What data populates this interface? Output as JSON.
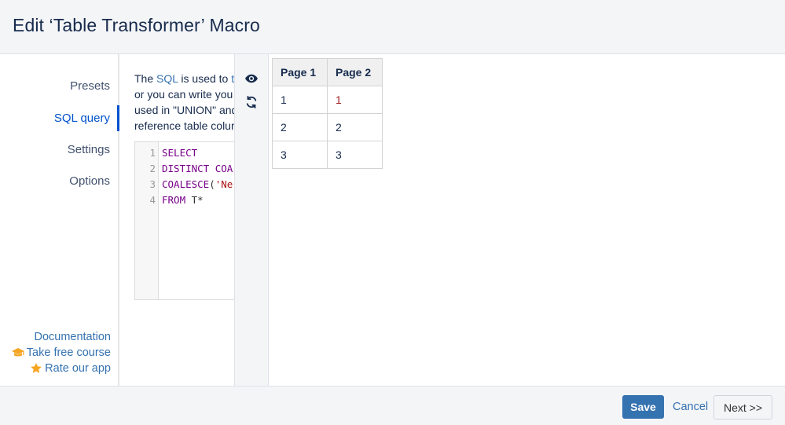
{
  "header": {
    "title": "Edit ‘Table Transformer’ Macro"
  },
  "sidebar": {
    "items": [
      {
        "label": "Presets"
      },
      {
        "label": "SQL query",
        "active": true
      },
      {
        "label": "Settings"
      },
      {
        "label": "Options"
      }
    ],
    "links": [
      {
        "label": "Documentation",
        "icon": ""
      },
      {
        "label": "Take free course",
        "icon": "graduation-cap-icon"
      },
      {
        "label": "Rate our app",
        "icon": "star-icon"
      }
    ]
  },
  "description": {
    "lines": [
      {
        "pre": "The ",
        "link": "SQL",
        "mid": " is used to ",
        "link2": "tr",
        "post": ""
      },
      {
        "text": "or you can write you"
      },
      {
        "text": "used in \"UNION\" and"
      },
      {
        "text": "reference table colum"
      }
    ]
  },
  "editor": {
    "lines": [
      {
        "num": "1",
        "kw": "SELECT",
        "rest": ""
      },
      {
        "num": "2",
        "kw": "DISTINCT COA",
        "rest": ""
      },
      {
        "num": "3",
        "kw": "COALESCE",
        "paren": "(",
        "str": "'Ne"
      },
      {
        "num": "4",
        "kw": "FROM",
        "rest": " T*"
      }
    ]
  },
  "tools": {
    "preview_icon": "eye-icon",
    "refresh_icon": "refresh-icon"
  },
  "preview_table": {
    "headers": [
      "Page 1",
      "Page 2"
    ],
    "rows": [
      [
        "1",
        "1"
      ],
      [
        "2",
        "2"
      ],
      [
        "3",
        "3"
      ]
    ]
  },
  "footer": {
    "save_label": "Save",
    "cancel_label": "Cancel",
    "next_label": "Next >>"
  },
  "colors": {
    "accent": "#3572b0",
    "active_nav": "#0052cc",
    "keyword": "#770088",
    "string": "#aa1111",
    "icon_orange": "#f5a623"
  }
}
